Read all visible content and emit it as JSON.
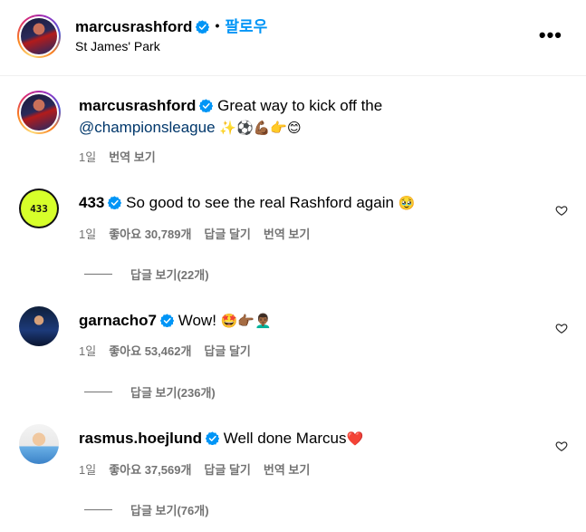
{
  "header": {
    "username": "marcusrashford",
    "separator": "•",
    "follow_label": "팔로우",
    "location": "St James' Park",
    "more_label": "•••"
  },
  "caption": {
    "username": "marcusrashford",
    "text_before": "Great way to kick off the",
    "mention": "@championsleague",
    "emojis": "✨⚽💪🏾👉😊",
    "time": "1일",
    "translate": "번역 보기"
  },
  "comments": [
    {
      "username": "433",
      "text": "So good to see the real Rashford again",
      "emojis": "🥹",
      "avatar_text": "433",
      "time": "1일",
      "likes": "좋아요 30,789개",
      "reply": "답글 달기",
      "translate": "번역 보기",
      "view_replies": "답글 보기(22개)"
    },
    {
      "username": "garnacho7",
      "text": "Wow!",
      "emojis": "🤩👉🏾👨🏾‍🦱",
      "time": "1일",
      "likes": "좋아요 53,462개",
      "reply": "답글 달기",
      "view_replies": "답글 보기(236개)"
    },
    {
      "username": "rasmus.hoejlund",
      "text": "Well done Marcus",
      "emojis": "❤️",
      "time": "1일",
      "likes": "좋아요 37,569개",
      "reply": "답글 달기",
      "translate": "번역 보기",
      "view_replies": "답글 보기(76개)"
    }
  ],
  "icons": {
    "verified": "verified-badge-icon",
    "heart": "heart-outline-icon",
    "more": "more-horizontal-icon"
  },
  "colors": {
    "verified_blue": "#0095f6",
    "follow_blue": "#0095f6",
    "mention_blue": "#00376b",
    "secondary_text": "#737373"
  }
}
